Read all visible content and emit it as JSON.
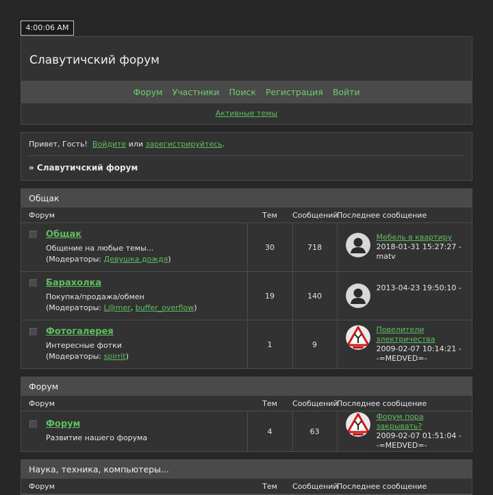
{
  "clock": "4:00:06 AM",
  "site_title": "Славутичский форум",
  "nav": [
    "Форум",
    "Участники",
    "Поиск",
    "Регистрация",
    "Войти"
  ],
  "active_topics": "Активные темы",
  "welcome": {
    "greeting": "Привет, Гость!",
    "login": "Войдите",
    "or": "или",
    "register": "зарегистрируйтесь",
    "dot": "."
  },
  "breadcrumb": "» Славутичский форум",
  "columns": {
    "forum": "Форум",
    "topics": "Тем",
    "posts": "Сообщений",
    "last_post": "Последнее сообщение"
  },
  "moderators_label": "(Модераторы: ",
  "categories": [
    {
      "title": "Общак",
      "forums": [
        {
          "name": "Общак",
          "desc": "Общение на любые темы...",
          "moderators": [
            "Девушка дождя"
          ],
          "topics": "30",
          "posts": "718",
          "avatar": "user-silhouette",
          "last_title": "Мебель в квартиру",
          "last_date": "2018-01-31 15:27:27 -",
          "last_author": "matv"
        },
        {
          "name": "Барахолка",
          "desc": "Покупка/продажа/обмен",
          "moderators": [
            "L@mer",
            "buffer_overflow"
          ],
          "topics": "19",
          "posts": "140",
          "avatar": "user-silhouette",
          "last_title": "",
          "last_date": "2013-04-23 19:50:10 -",
          "last_author": ""
        },
        {
          "name": "Фотогалерея",
          "desc": "Интересные фотки",
          "moderators": [
            "spirrit"
          ],
          "topics": "1",
          "posts": "9",
          "avatar": "warning-sign",
          "last_title": "Повелители электричества",
          "last_date": "2009-02-07 10:14:21 -",
          "last_author": "-=MEDVED=-"
        }
      ]
    },
    {
      "title": "Форум",
      "forums": [
        {
          "name": "Форум",
          "desc": "Развитие нашего форума",
          "moderators": [],
          "topics": "4",
          "posts": "63",
          "avatar": "warning-sign",
          "last_title": "Форум пора закрывать?",
          "last_date": "2009-02-07 01:51:04 -",
          "last_author": "-=MEDVED=-"
        }
      ]
    },
    {
      "title": "Наука, техника, компьютеры...",
      "forums": []
    }
  ]
}
